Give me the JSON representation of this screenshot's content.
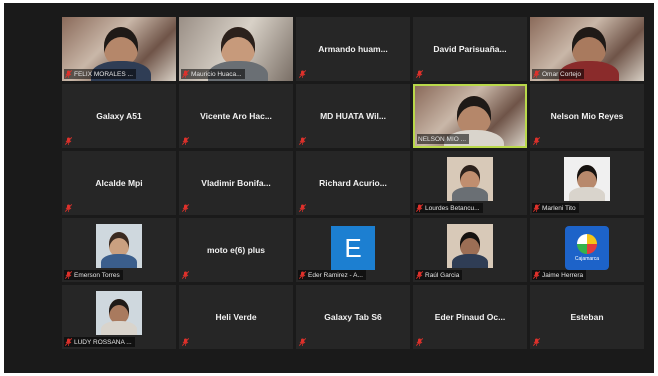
{
  "app": {
    "colors": {
      "tile_bg": "#262626",
      "active_border": "#b9d84a",
      "mute_icon": "#e0312b"
    }
  },
  "participants": [
    {
      "label": "FELIX MORALES ...",
      "kind": "video",
      "muted": true
    },
    {
      "label": "Mauricio Huaca...",
      "kind": "video",
      "muted": true
    },
    {
      "label": "Armando huam...",
      "kind": "name",
      "muted": true
    },
    {
      "label": "David Parisuaña...",
      "kind": "name",
      "muted": true
    },
    {
      "label": "Omar Cortejo",
      "kind": "video",
      "muted": true
    },
    {
      "label": "Galaxy A51",
      "kind": "name",
      "muted": true
    },
    {
      "label": "Vicente Aro Hac...",
      "kind": "name",
      "muted": true
    },
    {
      "label": "MD HUATA Wil...",
      "kind": "name",
      "muted": true
    },
    {
      "label": "NELSON MIO ...",
      "kind": "video",
      "muted": false,
      "active": true
    },
    {
      "label": "Nelson Mio Reyes",
      "kind": "name",
      "muted": true
    },
    {
      "label": "Alcalde Mpi",
      "kind": "name",
      "muted": true
    },
    {
      "label": "Vladimir Bonifa...",
      "kind": "name",
      "muted": true
    },
    {
      "label": "Richard Acurio...",
      "kind": "name",
      "muted": true
    },
    {
      "label": "Lourdes Betancu...",
      "kind": "thumb",
      "muted": true
    },
    {
      "label": "Marleni Tito",
      "kind": "thumb",
      "muted": true
    },
    {
      "label": "Emerson Torres",
      "kind": "thumb",
      "muted": true
    },
    {
      "label": "moto e(6) plus",
      "kind": "name",
      "muted": true
    },
    {
      "label": "Eder Ramirez - A...",
      "kind": "logo-e",
      "muted": true,
      "logo_text": "E"
    },
    {
      "label": "Raúl Garcia",
      "kind": "thumb",
      "muted": true
    },
    {
      "label": "Jaime Herrera",
      "kind": "logo-caja",
      "muted": true,
      "logo_text": "Cajamarca"
    },
    {
      "label": "LUDY ROSSANA ...",
      "kind": "thumb",
      "muted": true
    },
    {
      "label": "Heli Verde",
      "kind": "name",
      "muted": true
    },
    {
      "label": "Galaxy Tab S6",
      "kind": "name",
      "muted": true
    },
    {
      "label": "Eder Pinaud Oc...",
      "kind": "name",
      "muted": true
    },
    {
      "label": "Esteban",
      "kind": "name",
      "muted": true
    }
  ]
}
